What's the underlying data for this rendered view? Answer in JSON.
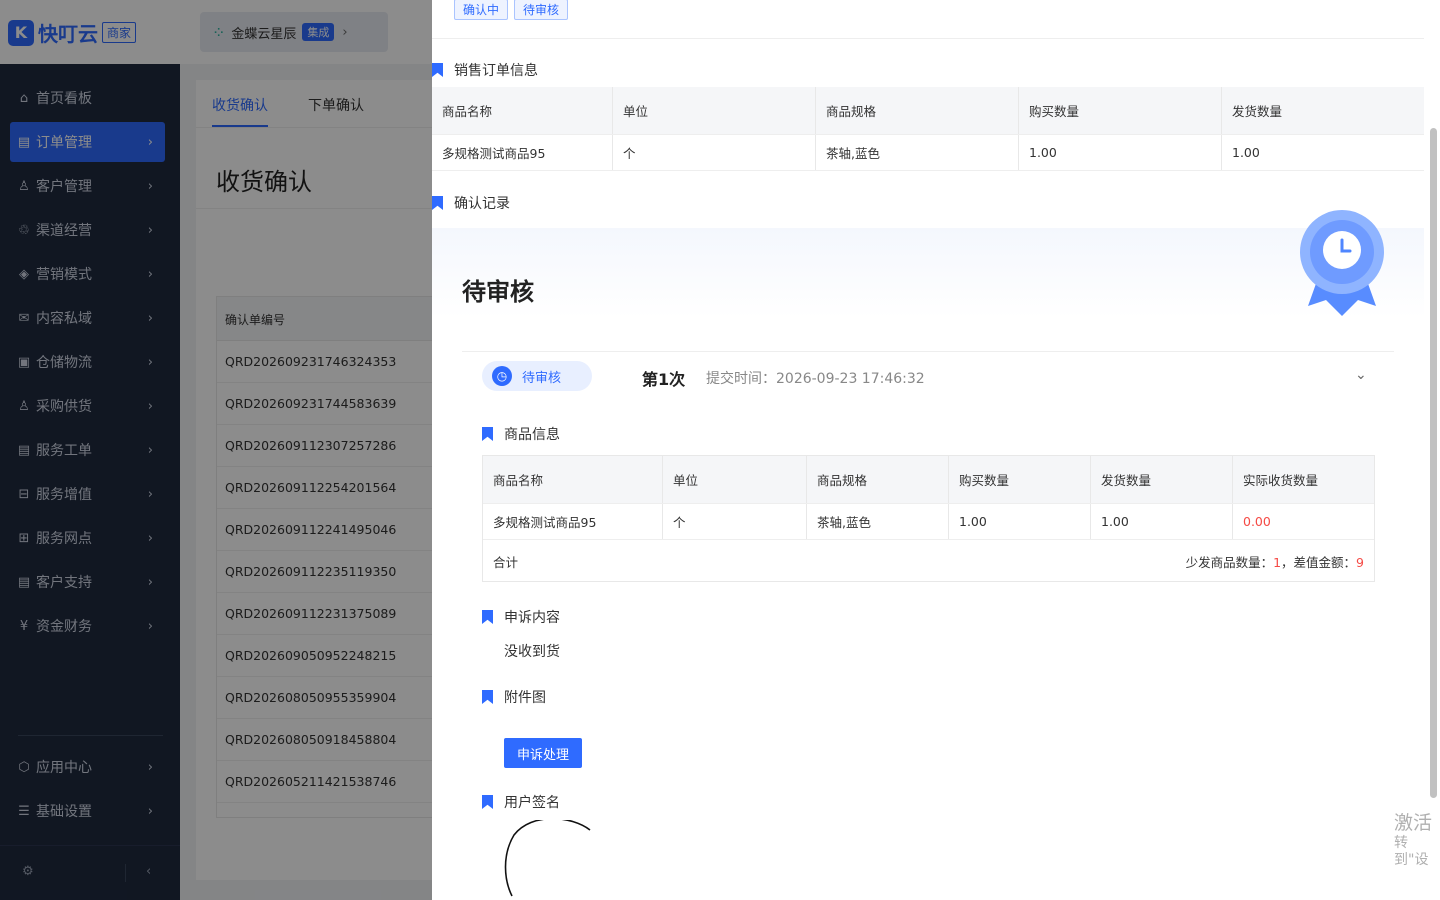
{
  "app": {
    "brand": "快叮云",
    "badge": "商家"
  },
  "shop": {
    "name": "金蝶云星辰",
    "badge": "集成"
  },
  "sidebar": {
    "items": [
      {
        "label": "首页看板",
        "icon": "home-icon"
      },
      {
        "label": "订单管理",
        "icon": "order-icon"
      },
      {
        "label": "客户管理",
        "icon": "user-icon"
      },
      {
        "label": "渠道经营",
        "icon": "channel-icon"
      },
      {
        "label": "营销模式",
        "icon": "tag-icon"
      },
      {
        "label": "内容私域",
        "icon": "mail-icon"
      },
      {
        "label": "仓储物流",
        "icon": "warehouse-icon"
      },
      {
        "label": "采购供货",
        "icon": "purchase-icon"
      },
      {
        "label": "服务工单",
        "icon": "ticket-icon"
      },
      {
        "label": "服务增值",
        "icon": "bag-icon"
      },
      {
        "label": "服务网点",
        "icon": "store-icon"
      },
      {
        "label": "客户支持",
        "icon": "support-icon"
      },
      {
        "label": "资金财务",
        "icon": "yen-icon"
      },
      {
        "label": "应用中心",
        "icon": "cube-icon"
      },
      {
        "label": "基础设置",
        "icon": "settings-icon"
      }
    ]
  },
  "main": {
    "tabs": [
      "收货确认",
      "下单确认"
    ],
    "title": "收货确认",
    "table_header": "确认单编号",
    "rows": [
      "QRD202609231746324353",
      "QRD202609231744583639",
      "QRD202609112307257286",
      "QRD202609112254201564",
      "QRD202609112241495046",
      "QRD202609112235119350",
      "QRD202609112231375089",
      "QRD202609050952248215",
      "QRD202608050955359904",
      "QRD202608050918458804",
      "QRD202605211421538746"
    ]
  },
  "drawer": {
    "tags": [
      "确认中",
      "待审核"
    ],
    "sales_section": "销售订单信息",
    "sales_headers": [
      "商品名称",
      "单位",
      "商品规格",
      "购买数量",
      "发货数量"
    ],
    "sales_row": [
      "多规格测试商品95",
      "个",
      "茶轴,蓝色",
      "1.00",
      "1.00"
    ],
    "record_section": "确认记录",
    "status_title": "待审核",
    "pill": "待审核",
    "times": "第1次",
    "submit_time": "提交时间：2026-09-23 17:46:32",
    "goods_section": "商品信息",
    "goods_headers": [
      "商品名称",
      "单位",
      "商品规格",
      "购买数量",
      "发货数量",
      "实际收货数量"
    ],
    "goods_row": [
      "多规格测试商品95",
      "个",
      "茶轴,蓝色",
      "1.00",
      "1.00",
      "0.00"
    ],
    "total_label": "合计",
    "short_label": "少发商品数量：",
    "short_value": "1",
    "diff_label": "，差值金额：",
    "diff_value": "9",
    "appeal_section": "申诉内容",
    "appeal_text": "没收到货",
    "attach_section": "附件图",
    "appeal_button": "申诉处理",
    "sign_section": "用户签名"
  },
  "watermark": {
    "line1": "激活",
    "line2": "转到\"设"
  },
  "colors": {
    "accent": "#2f6bff",
    "sidebar": "#1f2a3f",
    "error": "#f54a45"
  }
}
